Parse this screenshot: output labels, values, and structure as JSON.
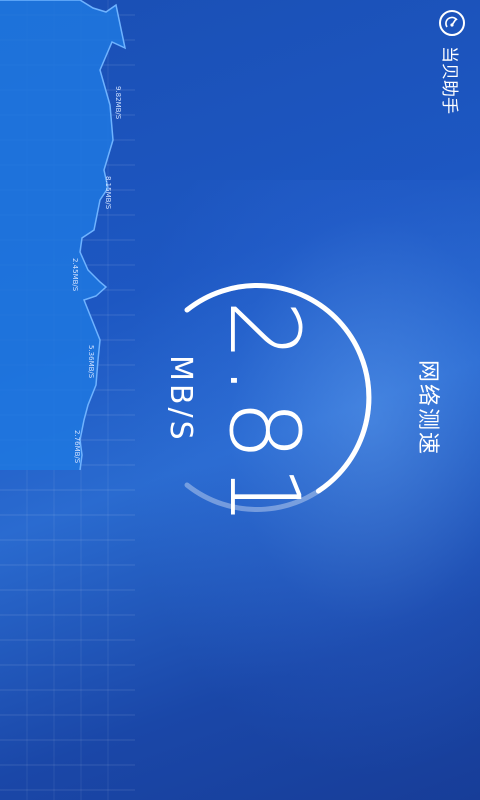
{
  "app": {
    "name": "当贝助手",
    "logo_icon": "speedometer-icon"
  },
  "speed_test": {
    "title": "网络测速",
    "current_value": "2.81",
    "unit": "MB/S",
    "progress": 0.72
  },
  "history_graph": {
    "tick_labels": [
      "9.82MB/S",
      "8.15MB/S",
      "2.45MB/S",
      "5.36MB/S",
      "2.76MB/S"
    ]
  },
  "colors": {
    "background": "#1d57c2",
    "graph_fill": "#1a6fd8",
    "graph_line": "#6fb3ff",
    "text": "#ffffff"
  }
}
